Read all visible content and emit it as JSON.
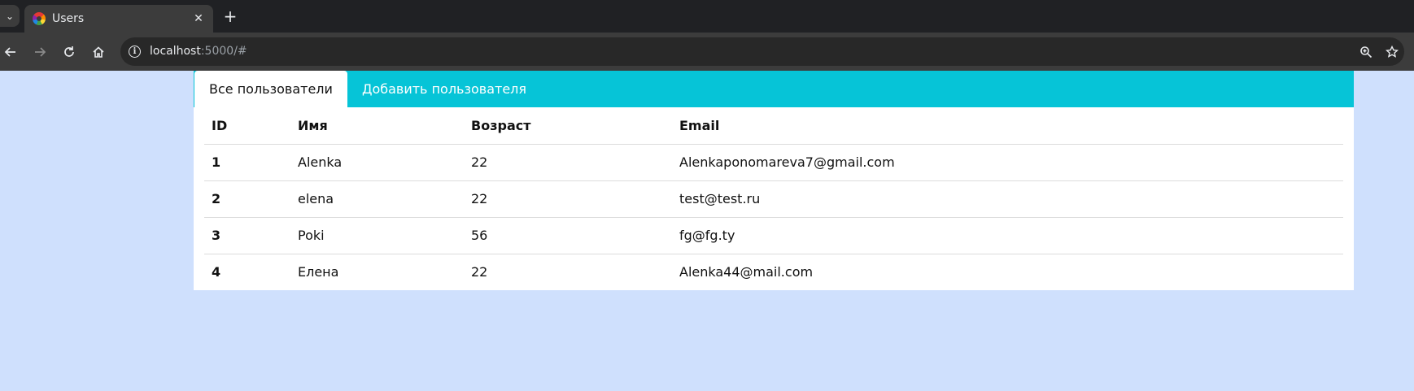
{
  "browser": {
    "tab_title": "Users",
    "tab_close": "✕",
    "new_tab": "+",
    "url_host": "localhost",
    "url_rest": ":5000/#"
  },
  "nav": {
    "tabs": [
      {
        "label": "Все пользователи",
        "active": true
      },
      {
        "label": "Добавить пользователя",
        "active": false
      }
    ]
  },
  "table": {
    "headers": [
      "ID",
      "Имя",
      "Возраст",
      "Email"
    ],
    "rows": [
      {
        "id": "1",
        "name": "Alenka",
        "age": "22",
        "email": "Alenkaponomareva7@gmail.com"
      },
      {
        "id": "2",
        "name": "elena",
        "age": "22",
        "email": "test@test.ru"
      },
      {
        "id": "3",
        "name": "Poki",
        "age": "56",
        "email": "fg@fg.ty"
      },
      {
        "id": "4",
        "name": "Елена",
        "age": "22",
        "email": "Alenka44@mail.com"
      }
    ]
  },
  "colors": {
    "page_background": "#cfe0fd",
    "tab_bar": "#06c4d7",
    "active_tab": "#ffffff"
  },
  "icons": [
    "chevron-down-icon",
    "app-favicon-icon",
    "close-icon",
    "plus-icon",
    "back-arrow-icon",
    "forward-arrow-icon",
    "reload-icon",
    "home-icon",
    "site-info-icon",
    "zoom-icon",
    "star-icon"
  ]
}
